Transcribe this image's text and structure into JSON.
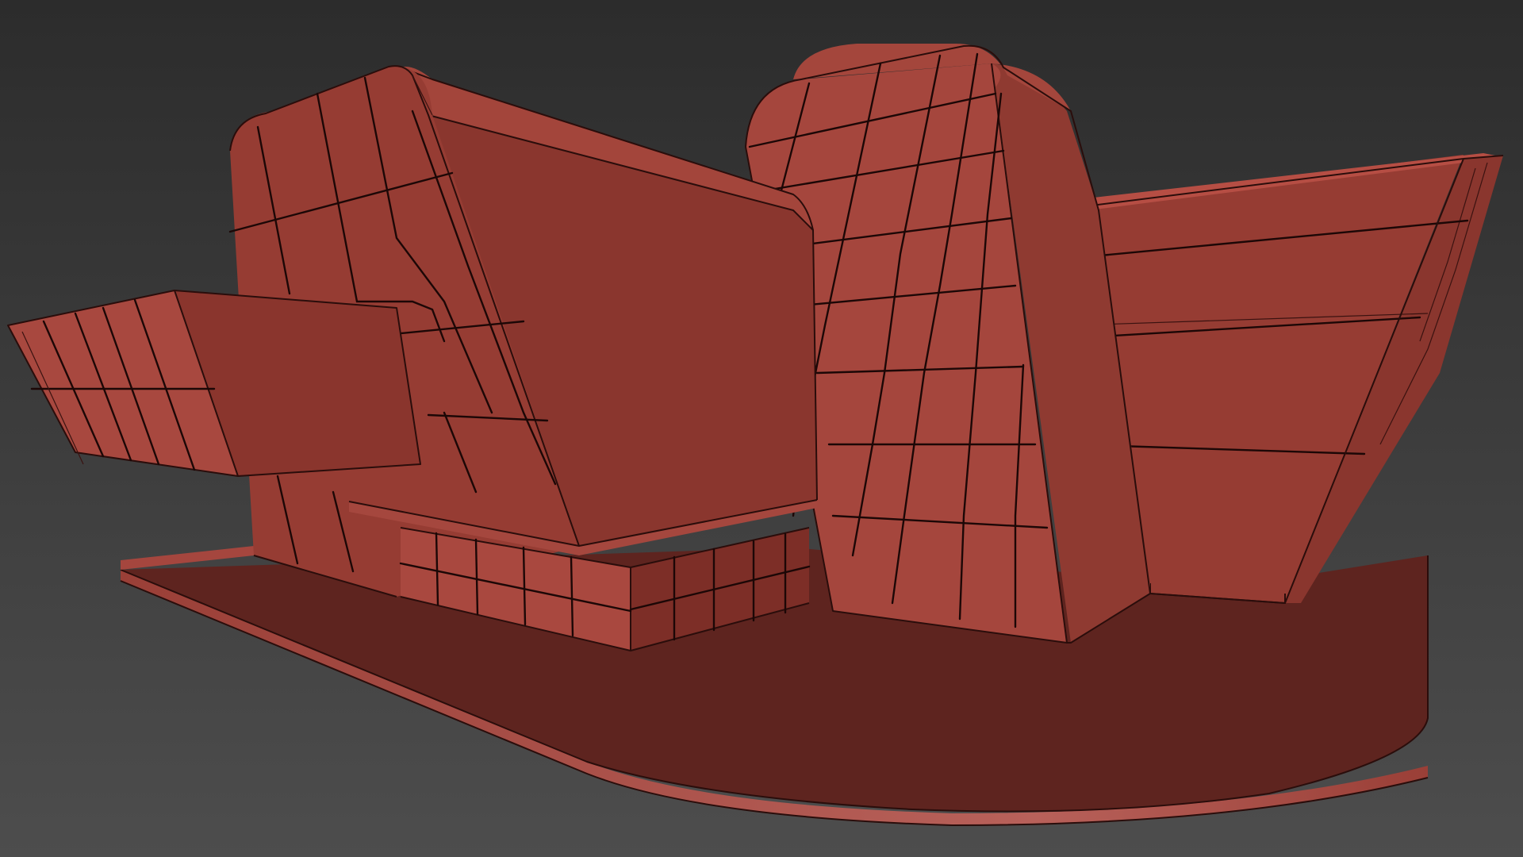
{
  "viewport": {
    "colors": {
      "background_top": "#2c2c2c",
      "background_bottom": "#4d4d4d",
      "model_light": "#a8463d",
      "model_mid": "#8f3a31",
      "model_dark": "#7a2f28",
      "base_top": "#5e241f",
      "base_edge": "#b0524b",
      "grid_line": "#1c0706"
    }
  }
}
